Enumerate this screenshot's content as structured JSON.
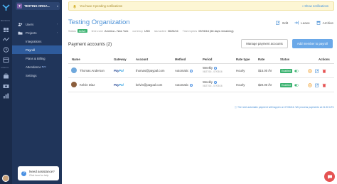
{
  "org": {
    "badge": "T",
    "name": "TESTING ORGA..."
  },
  "rail": {
    "label_metrics": "METRICS",
    "label_config": "CONFIG"
  },
  "nav": [
    {
      "label": "Users",
      "chev": "›"
    },
    {
      "label": "Projects",
      "chev": "›"
    },
    {
      "label": "Integrations",
      "chev": ""
    },
    {
      "label": "Payroll",
      "chev": ""
    },
    {
      "label": "Plans & Billing",
      "chev": ""
    },
    {
      "label": "Attendance",
      "chev": "",
      "sup": "BETA"
    },
    {
      "label": "Settings",
      "chev": ""
    }
  ],
  "help": {
    "title": "Need assistance?",
    "sub": "Click here for help",
    "icon": "?"
  },
  "notification": {
    "text": "You have 3 pending notifications",
    "link": "« Show notifications"
  },
  "header": {
    "title": "Testing Organization",
    "meta": {
      "status_label": "Status",
      "status_value": "Active",
      "tz_label": "time zone",
      "tz_value": "America - New York",
      "currency_label": "currency",
      "currency_value": "USD",
      "last_label": "last active",
      "last_value": "06/26/16",
      "trial_label": "Trial expires",
      "trial_value": "09/06/16 (68 days remaining)"
    },
    "actions": [
      "Edit",
      "Leave",
      "Archive"
    ]
  },
  "payments": {
    "title": "Payment accounts (2)",
    "manage_button": "Manage payment accounts",
    "add_button": "Add member to payroll",
    "columns": [
      "Name",
      "Gateway",
      "Account",
      "Method",
      "Period",
      "Rate type",
      "Rate",
      "Status",
      "Actions"
    ],
    "rows": [
      {
        "name": "Thomas Anderson",
        "gateway_a": "Pay",
        "gateway_b": "Pal",
        "account": "thomas@paypal.com",
        "method": "Automatic",
        "period": "Weekly",
        "period_range": "06/27/16 - 07/03/16",
        "rate_type": "Hourly",
        "rate": "$15.00 /hr",
        "status": "Enabled",
        "avatar_color": "#6fa8dc"
      },
      {
        "name": "Kelvin Diaz",
        "gateway_a": "Pay",
        "gateway_b": "Pal",
        "account": "kelvin@paypal.com",
        "method": "Automatic",
        "period": "Weekly",
        "period_range": "06/27/16 - 07/03/16",
        "rate_type": "Hourly",
        "rate": "$20.00 /hr",
        "status": "Enabled",
        "avatar_color": "#8b5e3c"
      }
    ],
    "footnote": "The next automatic payment will happen on 07/06/16. We process payments at 21:30 UTC"
  },
  "colors": {
    "accent": "#4a90d6",
    "sidebar": "#20355a",
    "rail": "#1a2b4a",
    "success": "#3cb371",
    "danger": "#e55353",
    "warning": "#f0a030"
  }
}
